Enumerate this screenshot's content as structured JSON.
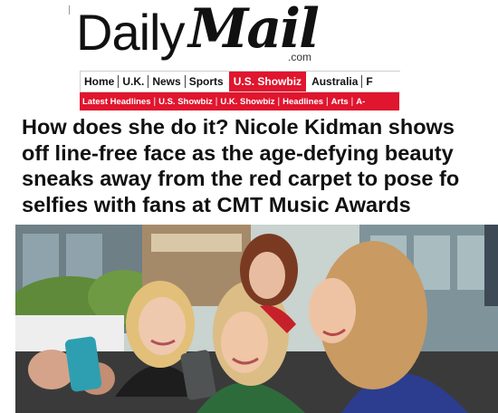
{
  "logo": {
    "daily": "Daily",
    "mail": "Mail",
    "com": ".com"
  },
  "nav": {
    "items": [
      {
        "label": "Home",
        "active": false
      },
      {
        "label": "U.K.",
        "active": false
      },
      {
        "label": "News",
        "active": false
      },
      {
        "label": "Sports",
        "active": false
      },
      {
        "label": "U.S. Showbiz",
        "active": true
      },
      {
        "label": "Australia",
        "active": false
      },
      {
        "label": "F",
        "active": false
      }
    ]
  },
  "subnav": {
    "items": [
      "Latest Headlines",
      "U.S. Showbiz",
      "U.K. Showbiz",
      "Headlines",
      "Arts",
      "A-"
    ]
  },
  "headline": {
    "line1": "How does she do it? Nicole Kidman shows",
    "line2": "off line-free face as the age-defying beauty",
    "line3": "sneaks away from the red carpet to pose fo",
    "line4": "selfies with fans at CMT Music Awards"
  },
  "colors": {
    "accent": "#e0152e",
    "text": "#111111"
  }
}
